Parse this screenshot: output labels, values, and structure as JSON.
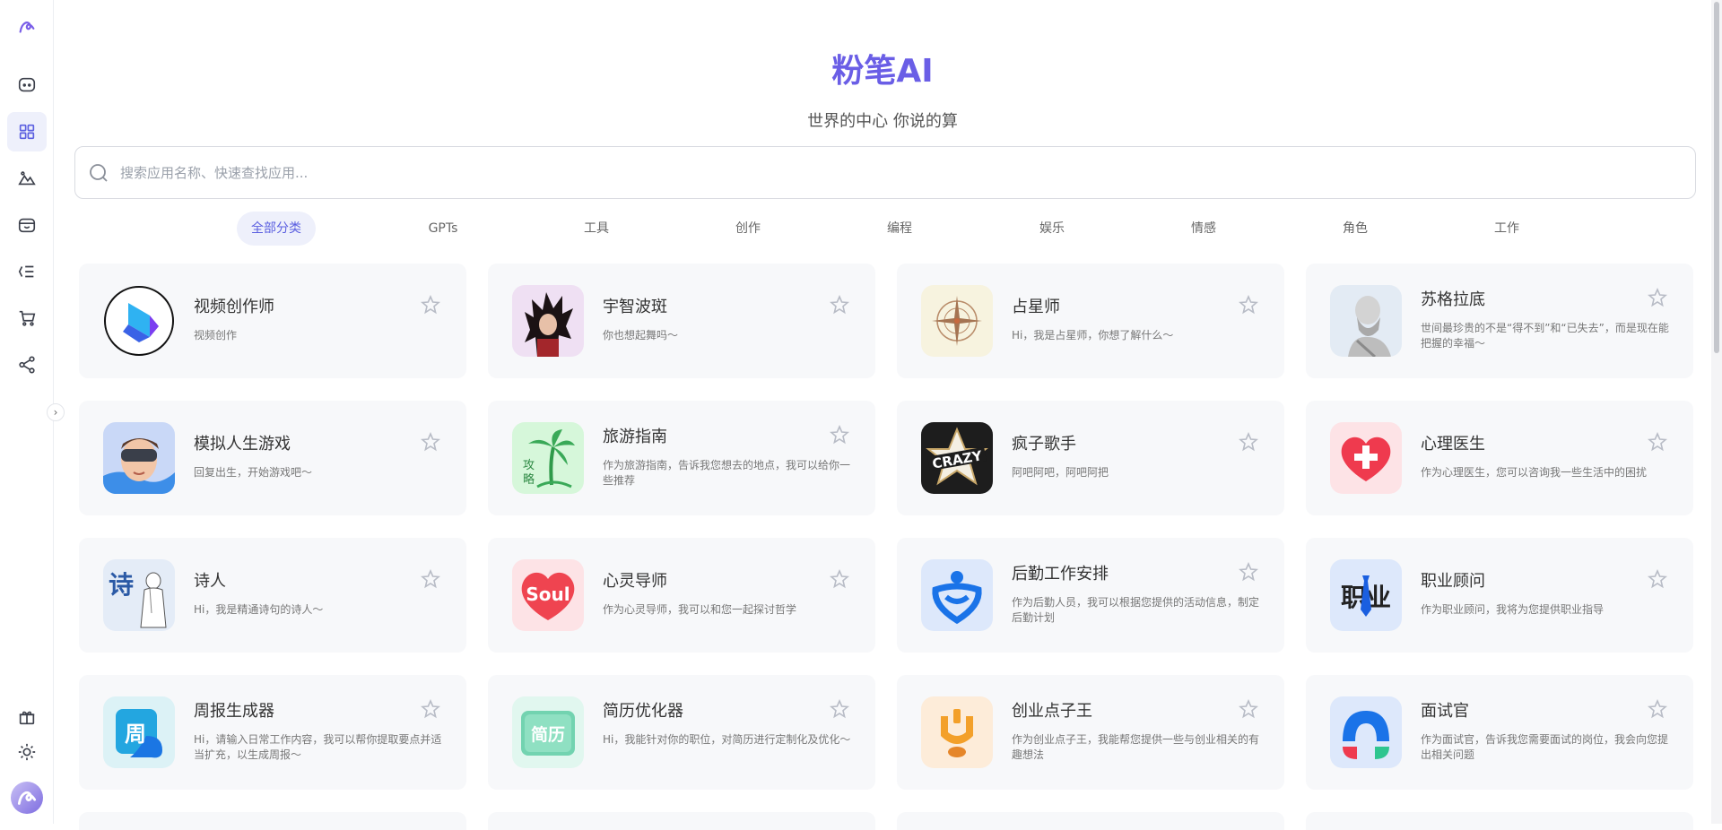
{
  "app": {
    "title": "粉笔AI",
    "subtitle": "世界的中心 你说的算"
  },
  "search": {
    "placeholder": "搜索应用名称、快速查找应用..."
  },
  "tabs": [
    {
      "label": "全部分类",
      "active": true
    },
    {
      "label": "GPTs"
    },
    {
      "label": "工具"
    },
    {
      "label": "创作"
    },
    {
      "label": "编程"
    },
    {
      "label": "娱乐"
    },
    {
      "label": "情感"
    },
    {
      "label": "角色"
    },
    {
      "label": "工作"
    }
  ],
  "sidebar": {
    "items": [
      {
        "icon": "logo-icon"
      },
      {
        "icon": "chat-icon"
      },
      {
        "icon": "apps-grid-icon",
        "active": true
      },
      {
        "icon": "image-icon"
      },
      {
        "icon": "wallet-icon"
      },
      {
        "icon": "list-icon"
      },
      {
        "icon": "cart-icon"
      },
      {
        "icon": "share-icon"
      },
      {
        "icon": "gift-icon"
      },
      {
        "icon": "sun-icon"
      }
    ]
  },
  "cards": [
    {
      "name": "视频创作师",
      "desc": "视频创作"
    },
    {
      "name": "宇智波斑",
      "desc": "你也想起舞吗～"
    },
    {
      "name": "占星师",
      "desc": "Hi，我是占星师，你想了解什么～"
    },
    {
      "name": "苏格拉底",
      "desc": "世间最珍贵的不是“得不到”和“已失去”，而是现在能把握的幸福～"
    },
    {
      "name": "模拟人生游戏",
      "desc": "回复出生，开始游戏吧～"
    },
    {
      "name": "旅游指南",
      "desc": "作为旅游指南，告诉我您想去的地点，我可以给你一些推荐"
    },
    {
      "name": "疯子歌手",
      "desc": "阿吧阿吧，阿吧阿把"
    },
    {
      "name": "心理医生",
      "desc": "作为心理医生，您可以咨询我一些生活中的困扰"
    },
    {
      "name": "诗人",
      "desc": "Hi，我是精通诗句的诗人～"
    },
    {
      "name": "心灵导师",
      "desc": "作为心灵导师，我可以和您一起探讨哲学"
    },
    {
      "name": "后勤工作安排",
      "desc": "作为后勤人员，我可以根据您提供的活动信息，制定后勤计划"
    },
    {
      "name": "职业顾问",
      "desc": "作为职业顾问，我将为您提供职业指导"
    },
    {
      "name": "周报生成器",
      "desc": "Hi，请输入日常工作内容，我可以帮你提取要点并适当扩充，以生成周报～"
    },
    {
      "name": "简历优化器",
      "desc": "Hi，我能针对你的职位，对简历进行定制化及优化～"
    },
    {
      "name": "创业点子王",
      "desc": "作为创业点子王，我能帮您提供一些与创业相关的有趣想法"
    },
    {
      "name": "面试官",
      "desc": "作为面试官，告诉我您需要面试的岗位，我会向您提出相关问题"
    }
  ],
  "thumb_text": {
    "crazy": "CRAZY",
    "travel": "攻略",
    "poet": "诗",
    "soul": "Soul",
    "career": "职业",
    "weekly": "周",
    "resume": "简历"
  },
  "colors": {
    "accent": "#5b5fe0",
    "title": "#6a5ee6"
  }
}
